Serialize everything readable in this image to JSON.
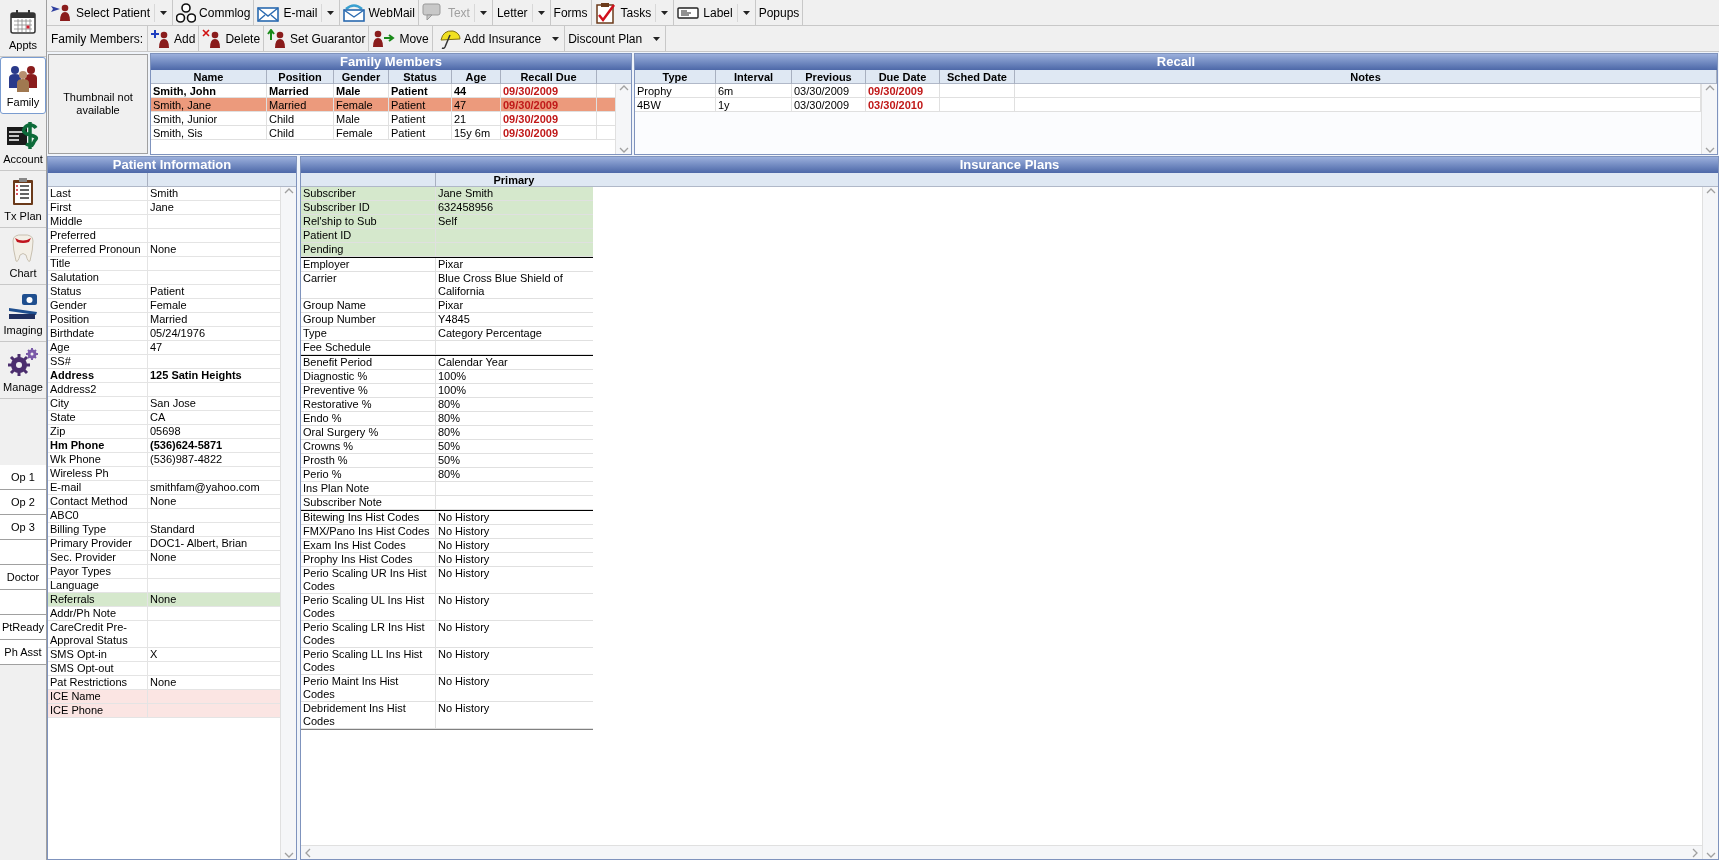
{
  "sidebar": {
    "modules": [
      {
        "label": "Appts",
        "selected": false
      },
      {
        "label": "Family",
        "selected": true
      },
      {
        "label": "Account",
        "selected": false
      },
      {
        "label": "Tx Plan",
        "selected": false
      },
      {
        "label": "Chart",
        "selected": false
      },
      {
        "label": "Imaging",
        "selected": false
      },
      {
        "label": "Manage",
        "selected": false
      }
    ],
    "ops": [
      {
        "kind": "button",
        "label": "Op 1"
      },
      {
        "kind": "button",
        "label": "Op 2"
      },
      {
        "kind": "button",
        "label": "Op 3"
      },
      {
        "kind": "blank"
      },
      {
        "kind": "button",
        "label": "Doctor"
      },
      {
        "kind": "blank"
      },
      {
        "kind": "button",
        "label": "PtReady"
      },
      {
        "kind": "button",
        "label": "Ph Asst"
      }
    ]
  },
  "main_toolbar": [
    {
      "label": "Select Patient",
      "dropdown": true,
      "disabled": false
    },
    {
      "label": "Commlog",
      "dropdown": false,
      "disabled": false
    },
    {
      "label": "E-mail",
      "dropdown": true,
      "disabled": false
    },
    {
      "label": "WebMail",
      "dropdown": false,
      "disabled": false
    },
    {
      "label": "Text",
      "dropdown": true,
      "disabled": true
    },
    {
      "label": "Letter",
      "dropdown": true,
      "disabled": false
    },
    {
      "label": "Forms",
      "dropdown": false,
      "disabled": false
    },
    {
      "label": "Tasks",
      "dropdown": true,
      "disabled": false
    },
    {
      "label": "Label",
      "dropdown": true,
      "disabled": false
    },
    {
      "label": "Popups",
      "dropdown": false,
      "disabled": false
    }
  ],
  "family_toolbar": {
    "label": "Family Members:",
    "buttons": [
      {
        "label": "Add",
        "dropdown": false
      },
      {
        "label": "Delete",
        "dropdown": false
      },
      {
        "label": "Set Guarantor",
        "dropdown": false
      },
      {
        "label": "Move",
        "dropdown": false
      },
      {
        "label": "Add Insurance",
        "dropdown": true
      },
      {
        "label": "Discount Plan",
        "dropdown": true
      }
    ]
  },
  "thumbnail": {
    "text": "Thumbnail not available"
  },
  "family_members": {
    "title": "Family Members",
    "columns": [
      "Name",
      "Position",
      "Gender",
      "Status",
      "Age",
      "Recall Due"
    ],
    "rows": [
      {
        "cells": [
          "Smith, John",
          "Married",
          "Male",
          "Patient",
          "44",
          "09/30/2009"
        ],
        "bold": true,
        "selected": false
      },
      {
        "cells": [
          "Smith, Jane",
          "Married",
          "Female",
          "Patient",
          "47",
          "09/30/2009"
        ],
        "bold": false,
        "selected": true
      },
      {
        "cells": [
          "Smith, Junior",
          "Child",
          "Male",
          "Patient",
          "21",
          "09/30/2009"
        ],
        "bold": false,
        "selected": false
      },
      {
        "cells": [
          "Smith, Sis",
          "Child",
          "Female",
          "Patient",
          "15y 6m",
          "09/30/2009"
        ],
        "bold": false,
        "selected": false
      }
    ]
  },
  "recall": {
    "title": "Recall",
    "columns": [
      "Type",
      "Interval",
      "Previous",
      "Due Date",
      "Sched Date",
      "Notes"
    ],
    "rows": [
      {
        "cells": [
          "Prophy",
          "6m",
          "03/30/2009",
          "09/30/2009"
        ]
      },
      {
        "cells": [
          "4BW",
          "1y",
          "03/30/2009",
          "03/30/2010"
        ]
      }
    ]
  },
  "patient_information": {
    "title": "Patient Information",
    "rows": [
      {
        "label": "Last",
        "value": "Smith",
        "bold": false
      },
      {
        "label": "First",
        "value": "Jane",
        "bold": false
      },
      {
        "label": "Middle",
        "bold": false
      },
      {
        "label": "Preferred",
        "bold": false
      },
      {
        "label": "Preferred Pronoun",
        "value": "None",
        "bold": false
      },
      {
        "label": "Title",
        "bold": false
      },
      {
        "label": "Salutation",
        "bold": false
      },
      {
        "label": "Status",
        "value": "Patient",
        "bold": false
      },
      {
        "label": "Gender",
        "value": "Female",
        "bold": false
      },
      {
        "label": "Position",
        "value": "Married",
        "bold": false
      },
      {
        "label": "Birthdate",
        "value": "05/24/1976",
        "bold": false
      },
      {
        "label": "Age",
        "value": "47",
        "bold": false
      },
      {
        "label": "SS#",
        "bold": false
      },
      {
        "label": "Address",
        "value": "125 Satin Heights",
        "bold": true
      },
      {
        "label": "Address2",
        "bold": false
      },
      {
        "label": "City",
        "value": "San Jose",
        "bold": false
      },
      {
        "label": "State",
        "value": "CA",
        "bold": false
      },
      {
        "label": "Zip",
        "value": "05698",
        "bold": false
      },
      {
        "label": "Hm Phone",
        "value": "(536)624-5871",
        "bold": true
      },
      {
        "label": "Wk Phone",
        "value": "(536)987-4822",
        "bold": false
      },
      {
        "label": "Wireless Ph",
        "bold": false
      },
      {
        "label": "E-mail",
        "value": "smithfam@yahoo.com",
        "bold": false
      },
      {
        "label": "Contact Method",
        "value": "None",
        "bold": false
      },
      {
        "label": "ABC0",
        "bold": false
      },
      {
        "label": "Billing Type",
        "value": "Standard",
        "bold": false
      },
      {
        "label": "Primary Provider",
        "value": "DOC1- Albert, Brian",
        "bold": false
      },
      {
        "label": "Sec. Provider",
        "value": "None",
        "bold": false
      },
      {
        "label": "Payor Types",
        "bold": false
      },
      {
        "label": "Language",
        "bold": false
      },
      {
        "label": "Referrals",
        "value": "None",
        "bold": false,
        "color": "#d5e8cc"
      },
      {
        "label": "Addr/Ph Note",
        "bold": false
      },
      {
        "label": "CareCredit Pre-Approval Status",
        "bold": false
      },
      {
        "label": "SMS Opt-in",
        "value": "X",
        "bold": false
      },
      {
        "label": "SMS Opt-out",
        "bold": false
      },
      {
        "label": "Pat Restrictions",
        "value": "None",
        "bold": false
      },
      {
        "label": "ICE Name",
        "bold": false,
        "color": "#fbe5e3"
      },
      {
        "label": "ICE Phone",
        "bold": false,
        "color": "#fbe5e3"
      }
    ]
  },
  "insurance_plans": {
    "title": "Insurance Plans",
    "column": "Primary",
    "sections": [
      {
        "color": "#d5e8cc",
        "rows": [
          {
            "label": "Subscriber",
            "value": "Jane Smith"
          },
          {
            "label": "Subscriber ID",
            "value": "632458956"
          },
          {
            "label": "Rel'ship to Sub",
            "value": "Self"
          },
          {
            "label": "Patient ID"
          },
          {
            "label": "Pending"
          }
        ]
      },
      {
        "rows": [
          {
            "label": "Employer",
            "value": "Pixar"
          },
          {
            "label": "Carrier",
            "value": "Blue Cross Blue Shield of California"
          },
          {
            "label": "Group Name",
            "value": "Pixar"
          },
          {
            "label": "Group Number",
            "value": "Y4845"
          },
          {
            "label": "Type",
            "value": "Category Percentage"
          },
          {
            "label": "Fee Schedule"
          }
        ]
      },
      {
        "rows": [
          {
            "label": "Benefit Period",
            "value": "Calendar Year"
          },
          {
            "label": "Diagnostic %",
            "value": "100%"
          },
          {
            "label": "Preventive %",
            "value": "100%"
          },
          {
            "label": "Restorative %",
            "value": "80%"
          },
          {
            "label": "Endo %",
            "value": "80%"
          },
          {
            "label": "Oral Surgery %",
            "value": "80%"
          },
          {
            "label": "Crowns %",
            "value": "50%"
          },
          {
            "label": "Prosth %",
            "value": "50%"
          },
          {
            "label": "Perio %",
            "value": "80%"
          },
          {
            "label": "Ins Plan Note"
          },
          {
            "label": "Subscriber Note"
          }
        ]
      },
      {
        "rows": [
          {
            "label": "Bitewing Ins Hist Codes",
            "value": "No History"
          },
          {
            "label": "FMX/Pano Ins Hist Codes",
            "value": "No History"
          },
          {
            "label": "Exam Ins Hist Codes",
            "value": "No History"
          },
          {
            "label": "Prophy Ins Hist Codes",
            "value": "No History"
          },
          {
            "label": "Perio Scaling UR Ins Hist Codes",
            "value": "No History"
          },
          {
            "label": "Perio Scaling UL Ins Hist Codes",
            "value": "No History"
          },
          {
            "label": "Perio Scaling LR Ins Hist Codes",
            "value": "No History"
          },
          {
            "label": "Perio Scaling LL Ins Hist Codes",
            "value": "No History"
          },
          {
            "label": "Perio Maint Ins Hist Codes",
            "value": "No History"
          },
          {
            "label": "Debridement Ins Hist Codes",
            "value": "No History"
          }
        ]
      }
    ]
  }
}
